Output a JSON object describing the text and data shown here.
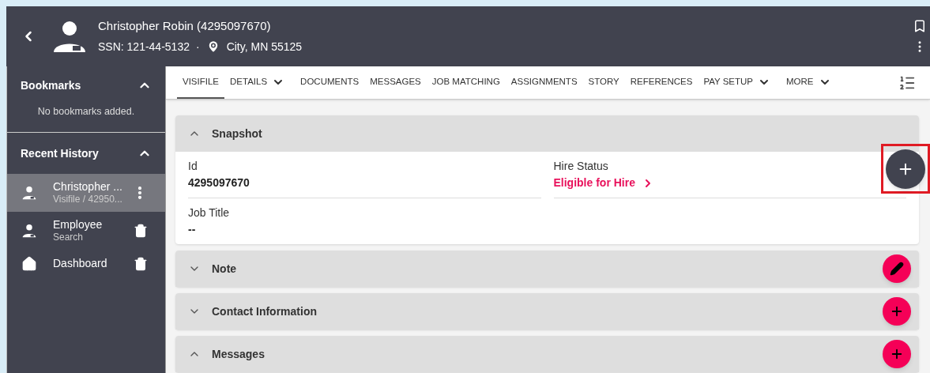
{
  "header": {
    "name": "Christopher Robin (4295097670)",
    "ssn": "SSN: 121-44-5132",
    "separator": "·",
    "location": "City, MN 55125"
  },
  "sidebar": {
    "bookmarks": {
      "title": "Bookmarks",
      "expanded": true,
      "empty_text": "No bookmarks added."
    },
    "recent_history": {
      "title": "Recent History",
      "expanded": true,
      "items": [
        {
          "kind": "person",
          "title": "Christopher ...",
          "subtitle": "Visifile / 42950...",
          "deletable": false,
          "selected": true
        },
        {
          "kind": "person",
          "title": "Employee",
          "subtitle": "Search",
          "deletable": true,
          "selected": false
        },
        {
          "kind": "home",
          "title": "Dashboard",
          "deletable": true,
          "selected": false
        }
      ]
    }
  },
  "tabs": [
    {
      "label": "VISIFILE",
      "dropdown": false,
      "selected": true
    },
    {
      "label": "DETAILS",
      "dropdown": true,
      "selected": false
    },
    {
      "label": "DOCUMENTS",
      "dropdown": false,
      "selected": false
    },
    {
      "label": "MESSAGES",
      "dropdown": false,
      "selected": false
    },
    {
      "label": "JOB MATCHING",
      "dropdown": false,
      "selected": false
    },
    {
      "label": "ASSIGNMENTS",
      "dropdown": false,
      "selected": false
    },
    {
      "label": "STORY",
      "dropdown": false,
      "selected": false
    },
    {
      "label": "REFERENCES",
      "dropdown": false,
      "selected": false
    },
    {
      "label": "PAY SETUP",
      "dropdown": true,
      "selected": false
    },
    {
      "label": "MORE",
      "dropdown": true,
      "selected": false
    }
  ],
  "sections": [
    {
      "title": "Snapshot",
      "expanded": true,
      "fab": {
        "kind": "add",
        "highlighted": true
      },
      "fields": [
        {
          "label": "Id",
          "value": "4295097670",
          "kind": "text"
        },
        {
          "label": "Hire Status",
          "value": "Eligible for Hire",
          "kind": "link"
        },
        {
          "label": "Job Title",
          "value": "--",
          "kind": "text"
        }
      ]
    },
    {
      "title": "Note",
      "expanded": false,
      "fab": {
        "kind": "edit",
        "highlighted": false
      }
    },
    {
      "title": "Contact Information",
      "expanded": false,
      "fab": {
        "kind": "add",
        "highlighted": false
      }
    },
    {
      "title": "Messages",
      "expanded": true,
      "fab": {
        "kind": "add",
        "highlighted": false
      }
    }
  ]
}
